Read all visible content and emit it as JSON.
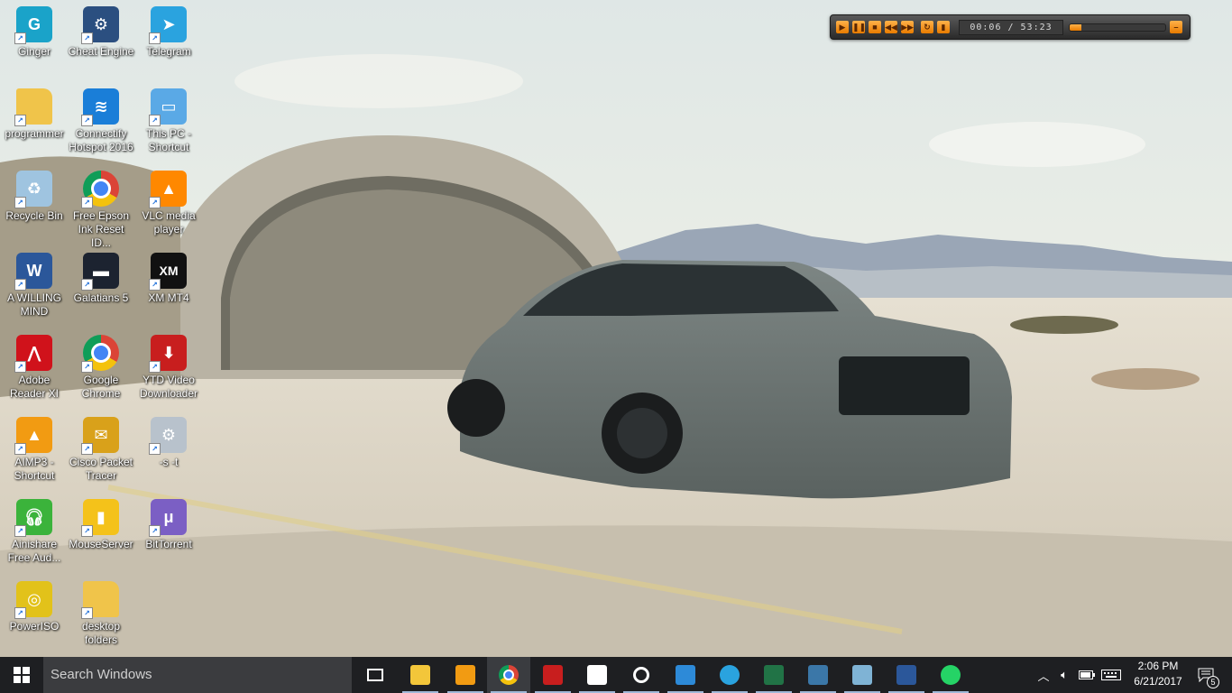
{
  "desktop": {
    "icons": [
      {
        "label": "Ginger",
        "icon": "ginger-icon",
        "color": "#1aa3c9"
      },
      {
        "label": "Cheat Engine",
        "icon": "cheat-engine-icon",
        "color": "#2b4f80"
      },
      {
        "label": "Telegram",
        "icon": "telegram-icon",
        "color": "#2aa3df"
      },
      {
        "label": "programmer",
        "icon": "folder-icon",
        "color": "#f0c44a"
      },
      {
        "label": "Connectify Hotspot 2016",
        "icon": "connectify-icon",
        "color": "#1a7ed8"
      },
      {
        "label": "This PC - Shortcut",
        "icon": "this-pc-icon",
        "color": "#5aa9e6"
      },
      {
        "label": "Recycle Bin",
        "icon": "recycle-bin-icon",
        "color": "#9fc4e0"
      },
      {
        "label": "Free Epson Ink Reset ID...",
        "icon": "chrome-icon",
        "color": "#db4437"
      },
      {
        "label": "VLC media player",
        "icon": "vlc-icon",
        "color": "#ff8800"
      },
      {
        "label": "A WILLING MIND",
        "icon": "word-document-icon",
        "color": "#2b579a"
      },
      {
        "label": "Galatians 5",
        "icon": "video-thumbnail-icon",
        "color": "#1c2330"
      },
      {
        "label": "XM MT4",
        "icon": "xm-mt4-icon",
        "color": "#111111"
      },
      {
        "label": "Adobe Reader XI",
        "icon": "adobe-reader-icon",
        "color": "#d0121b"
      },
      {
        "label": "Google Chrome",
        "icon": "chrome-icon",
        "color": "#db4437"
      },
      {
        "label": "YTD Video Downloader",
        "icon": "ytd-icon",
        "color": "#c81e1e"
      },
      {
        "label": "AIMP3 - Shortcut",
        "icon": "aimp-icon",
        "color": "#f29b12"
      },
      {
        "label": "Cisco Packet Tracer",
        "icon": "cisco-packet-tracer-icon",
        "color": "#d9a11a"
      },
      {
        "label": "-s -t",
        "icon": "settings-file-icon",
        "color": "#b8c2cc"
      },
      {
        "label": "Ainishare Free Aud...",
        "icon": "headphones-icon",
        "color": "#3bb33b"
      },
      {
        "label": "MouseServer",
        "icon": "mouse-server-icon",
        "color": "#f4c21a"
      },
      {
        "label": "BitTorrent",
        "icon": "bittorrent-icon",
        "color": "#7b5fc4"
      },
      {
        "label": "PowerISO",
        "icon": "poweriso-icon",
        "color": "#e2c21a"
      },
      {
        "label": "desktop folders",
        "icon": "folder-icon",
        "color": "#f0c44a"
      }
    ]
  },
  "media_player": {
    "time_display": "00:06 / 53:23",
    "progress": 0.12,
    "buttons": [
      "play",
      "pause",
      "stop",
      "previous",
      "next",
      "repeat",
      "equalizer",
      "minimize"
    ]
  },
  "taskbar": {
    "search_placeholder": "Search Windows",
    "apps": [
      {
        "name": "task-view",
        "icon": "task-view-icon"
      },
      {
        "name": "file-explorer",
        "icon": "file-explorer-icon"
      },
      {
        "name": "aimp",
        "icon": "aimp-icon"
      },
      {
        "name": "chrome",
        "icon": "chrome-icon"
      },
      {
        "name": "ytd",
        "icon": "ytd-icon"
      },
      {
        "name": "calculator",
        "icon": "calculator-icon"
      },
      {
        "name": "groove",
        "icon": "groove-music-icon"
      },
      {
        "name": "app-blue",
        "icon": "app-icon"
      },
      {
        "name": "telegram",
        "icon": "telegram-icon"
      },
      {
        "name": "excel",
        "icon": "excel-icon"
      },
      {
        "name": "python",
        "icon": "python-icon"
      },
      {
        "name": "app-notes",
        "icon": "notes-icon"
      },
      {
        "name": "word",
        "icon": "word-icon"
      },
      {
        "name": "whatsapp",
        "icon": "whatsapp-icon"
      }
    ],
    "clock_time": "2:06 PM",
    "clock_date": "6/21/2017",
    "notification_count": "5"
  },
  "colors": {
    "taskbar": "#1e1f22",
    "accent": "#f08a00"
  }
}
